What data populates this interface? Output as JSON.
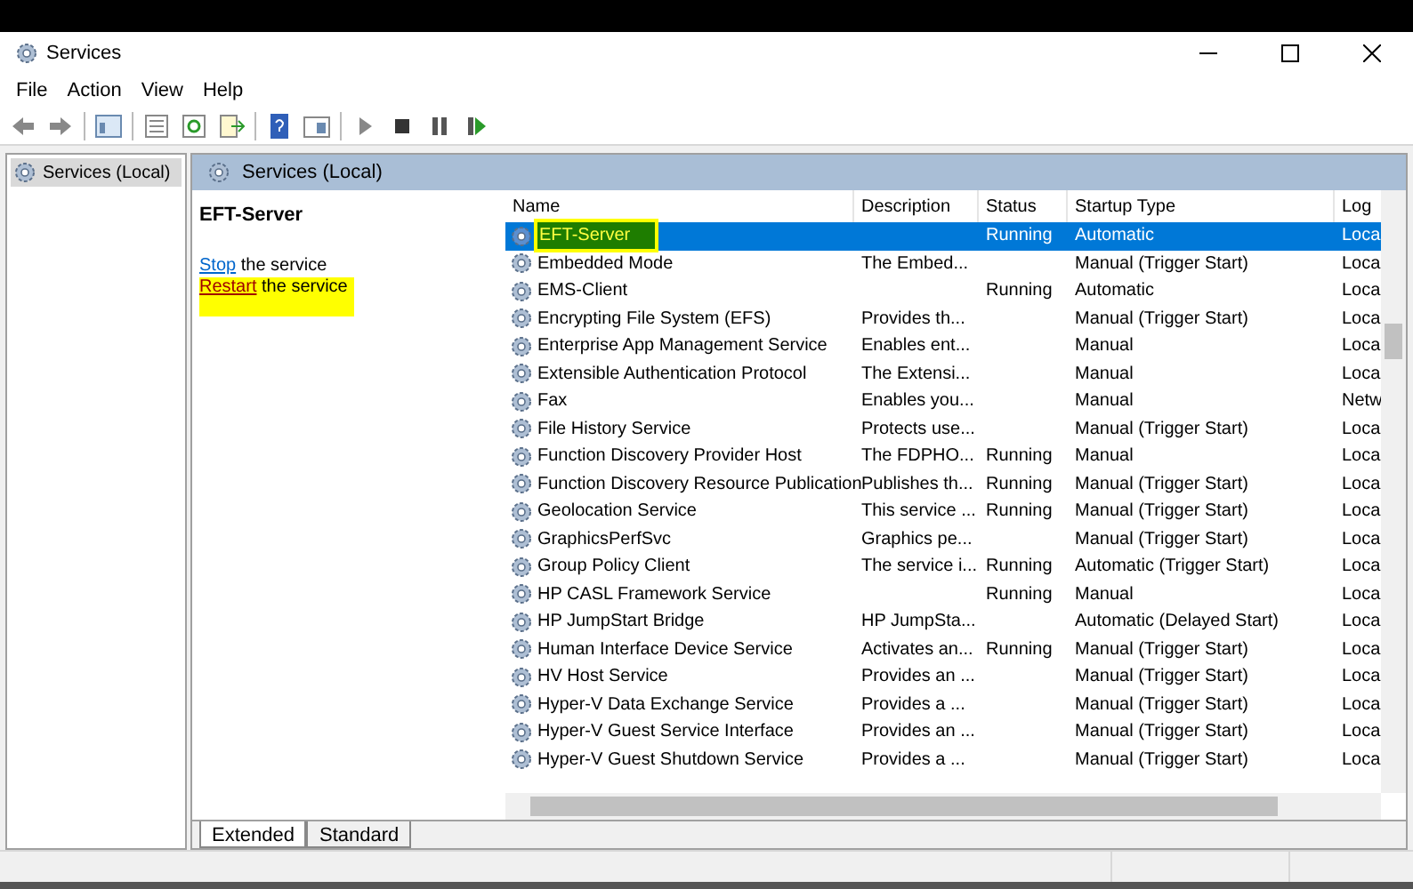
{
  "window": {
    "title": "Services"
  },
  "menu": [
    "File",
    "Action",
    "View",
    "Help"
  ],
  "tree": {
    "items": [
      {
        "label": "Services (Local)",
        "selected": true
      }
    ]
  },
  "panel": {
    "title": "Services (Local)"
  },
  "details": {
    "service_name": "EFT-Server",
    "actions": [
      {
        "link": "Stop",
        "rest": "the service",
        "highlighted": false
      },
      {
        "link": "Restart",
        "rest": "the service",
        "highlighted": true
      }
    ]
  },
  "table": {
    "columns": [
      "Name",
      "Description",
      "Status",
      "Startup Type",
      "Log"
    ],
    "rows": [
      {
        "name": "EFT-Server",
        "description": "",
        "status": "Running",
        "startup": "Automatic",
        "log": "Loca",
        "selected": true,
        "highlighted": true
      },
      {
        "name": "Embedded Mode",
        "description": "The Embed...",
        "status": "",
        "startup": "Manual (Trigger Start)",
        "log": "Loca",
        "selected": false,
        "highlighted": false
      },
      {
        "name": "EMS-Client",
        "description": "",
        "status": "Running",
        "startup": "Automatic",
        "log": "Loca",
        "selected": false,
        "highlighted": false
      },
      {
        "name": "Encrypting File System (EFS)",
        "description": "Provides th...",
        "status": "",
        "startup": "Manual (Trigger Start)",
        "log": "Loca",
        "selected": false,
        "highlighted": false
      },
      {
        "name": "Enterprise App Management Service",
        "description": "Enables ent...",
        "status": "",
        "startup": "Manual",
        "log": "Loca",
        "selected": false,
        "highlighted": false
      },
      {
        "name": "Extensible Authentication Protocol",
        "description": "The Extensi...",
        "status": "",
        "startup": "Manual",
        "log": "Loca",
        "selected": false,
        "highlighted": false
      },
      {
        "name": "Fax",
        "description": "Enables you...",
        "status": "",
        "startup": "Manual",
        "log": "Netw",
        "selected": false,
        "highlighted": false
      },
      {
        "name": "File History Service",
        "description": "Protects use...",
        "status": "",
        "startup": "Manual (Trigger Start)",
        "log": "Loca",
        "selected": false,
        "highlighted": false
      },
      {
        "name": "Function Discovery Provider Host",
        "description": "The FDPHO...",
        "status": "Running",
        "startup": "Manual",
        "log": "Loca",
        "selected": false,
        "highlighted": false
      },
      {
        "name": "Function Discovery Resource Publication",
        "description": "Publishes th...",
        "status": "Running",
        "startup": "Manual (Trigger Start)",
        "log": "Loca",
        "selected": false,
        "highlighted": false
      },
      {
        "name": "Geolocation Service",
        "description": "This service ...",
        "status": "Running",
        "startup": "Manual (Trigger Start)",
        "log": "Loca",
        "selected": false,
        "highlighted": false
      },
      {
        "name": "GraphicsPerfSvc",
        "description": "Graphics pe...",
        "status": "",
        "startup": "Manual (Trigger Start)",
        "log": "Loca",
        "selected": false,
        "highlighted": false
      },
      {
        "name": "Group Policy Client",
        "description": "The service i...",
        "status": "Running",
        "startup": "Automatic (Trigger Start)",
        "log": "Loca",
        "selected": false,
        "highlighted": false
      },
      {
        "name": "HP CASL Framework Service",
        "description": "",
        "status": "Running",
        "startup": "Manual",
        "log": "Loca",
        "selected": false,
        "highlighted": false
      },
      {
        "name": "HP JumpStart Bridge",
        "description": "HP JumpSta...",
        "status": "",
        "startup": "Automatic (Delayed Start)",
        "log": "Loca",
        "selected": false,
        "highlighted": false
      },
      {
        "name": "Human Interface Device Service",
        "description": "Activates an...",
        "status": "Running",
        "startup": "Manual (Trigger Start)",
        "log": "Loca",
        "selected": false,
        "highlighted": false
      },
      {
        "name": "HV Host Service",
        "description": "Provides an ...",
        "status": "",
        "startup": "Manual (Trigger Start)",
        "log": "Loca",
        "selected": false,
        "highlighted": false
      },
      {
        "name": "Hyper-V Data Exchange Service",
        "description": "Provides a ...",
        "status": "",
        "startup": "Manual (Trigger Start)",
        "log": "Loca",
        "selected": false,
        "highlighted": false
      },
      {
        "name": "Hyper-V Guest Service Interface",
        "description": "Provides an ...",
        "status": "",
        "startup": "Manual (Trigger Start)",
        "log": "Loca",
        "selected": false,
        "highlighted": false
      },
      {
        "name": "Hyper-V Guest Shutdown Service",
        "description": "Provides a ...",
        "status": "",
        "startup": "Manual (Trigger Start)",
        "log": "Loca",
        "selected": false,
        "highlighted": false
      }
    ]
  },
  "tabs": [
    {
      "label": "Extended",
      "selected": true
    },
    {
      "label": "Standard",
      "selected": false
    }
  ]
}
